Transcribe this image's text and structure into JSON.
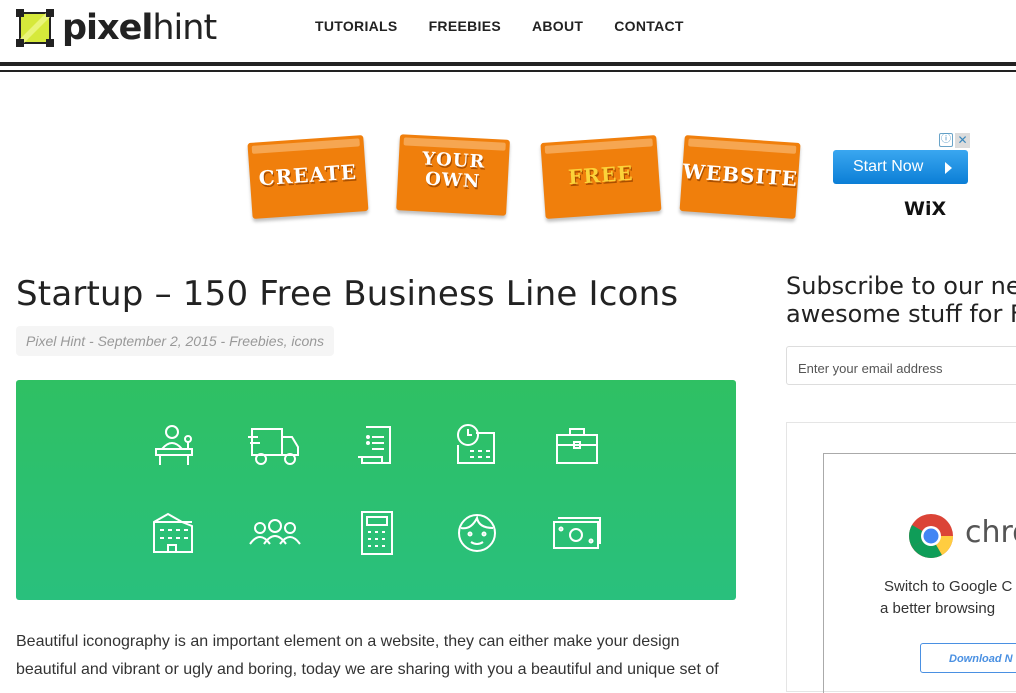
{
  "logo": {
    "bold": "pixel",
    "light": "hint"
  },
  "nav": [
    "TUTORIALS",
    "FREEBIES",
    "ABOUT",
    "CONTACT"
  ],
  "ad": {
    "tiles": [
      "CREATE",
      "YOUR OWN",
      "FREE",
      "WEBSITE"
    ],
    "button": "Start Now",
    "info_icon": "ⓘ",
    "close_icon": "✕",
    "brand": "WiX"
  },
  "post": {
    "title": "Startup – 150 Free Business Line Icons",
    "meta": "Pixel Hint - September 2, 2015 - Freebies, icons",
    "hero_icons": [
      "reception-desk-icon",
      "delivery-truck-icon",
      "invoice-icon",
      "schedule-calendar-icon",
      "briefcase-icon",
      "office-building-icon",
      "team-icon",
      "calculator-icon",
      "face-icon",
      "money-icon"
    ],
    "hero_colors": {
      "top": "#2fc063",
      "bottom": "#29c07d"
    },
    "body": "Beautiful iconography is an important element on a website, they can either make your design beautiful and vibrant or ugly and boring, today we are sharing with you a beautiful and unique set of"
  },
  "sidebar": {
    "subscribe_title_line1": "Subscribe to our new",
    "subscribe_title_line2": "awesome stuff for Fr",
    "email_placeholder": "Enter your email address",
    "chrome_ad": {
      "brand": "chro",
      "line1": "Switch to Google C",
      "line2": "a better browsing",
      "button": "Download N"
    }
  }
}
